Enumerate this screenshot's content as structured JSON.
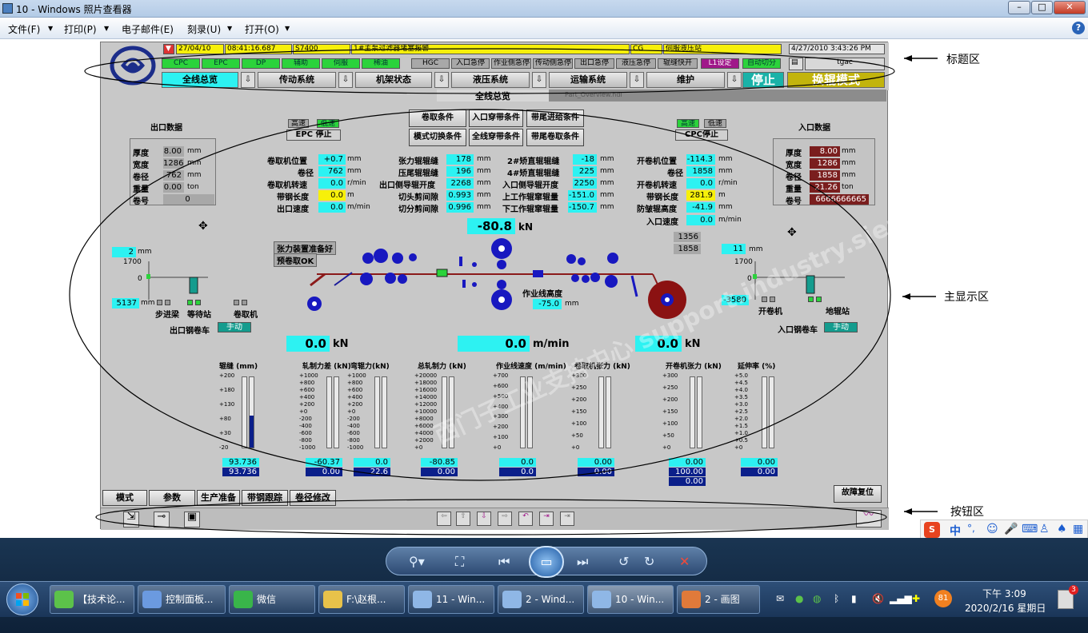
{
  "window": {
    "title": "10 - Windows 照片查看器"
  },
  "menu": [
    "文件(F)",
    "打印(P)",
    "电子邮件(E)",
    "刻录(U)",
    "打开(O)"
  ],
  "hmi": {
    "alarm": {
      "date": "27/04/10",
      "time": "08:41:16.687",
      "code": "S7400",
      "msg": "1#主泵过滤器堵塞报警",
      "cg": "CG",
      "station": "伺服液压站",
      "datetime": "4/27/2010 3:43:26 PM"
    },
    "status_row": [
      "CPC",
      "EPC",
      "DP",
      "辅助",
      "伺服",
      "稀油",
      "HGC",
      "入口急停",
      "作业侧急停",
      "传动侧急停",
      "出口急停",
      "液压急停",
      "辊缝快开",
      "L1设定",
      "自动切分"
    ],
    "user": "tgac",
    "nav": [
      "全线总览",
      "传动系统",
      "机架状态",
      "液压系统",
      "运输系统",
      "维护"
    ],
    "stop": "停止",
    "mode": "换辊模式",
    "page_title": "全线总览",
    "page_file": "Part_Overview.hdl",
    "exit_box": {
      "title": "出口数据",
      "rows": [
        {
          "label": "厚度",
          "value": "8.00",
          "unit": "mm"
        },
        {
          "label": "宽度",
          "value": "1286",
          "unit": "mm"
        },
        {
          "label": "卷径",
          "value": "762",
          "unit": "mm"
        },
        {
          "label": "重量",
          "value": "0.00",
          "unit": "ton"
        },
        {
          "label": "卷号",
          "value": "0",
          "unit": ""
        }
      ]
    },
    "entry_box": {
      "title": "入口数据",
      "rows": [
        {
          "label": "厚度",
          "value": "8.00",
          "unit": "mm"
        },
        {
          "label": "宽度",
          "value": "1286",
          "unit": "mm"
        },
        {
          "label": "卷径",
          "value": "1858",
          "unit": "mm"
        },
        {
          "label": "重量",
          "value": "21.26",
          "unit": "ton"
        },
        {
          "label": "卷号",
          "value": "6666666665",
          "unit": ""
        }
      ]
    },
    "epc": {
      "hi": "高速",
      "lo": "低速",
      "label": "EPC 停止"
    },
    "cpc": {
      "hi": "高速",
      "lo": "低速",
      "label": "CPC停止"
    },
    "conditions": [
      "卷取条件",
      "入口穿带条件",
      "带尾进给条件",
      "模式切换条件",
      "全线穿带条件",
      "带尾卷取条件"
    ],
    "col1": [
      {
        "label": "卷取机位置",
        "value": "+0.7",
        "unit": "mm"
      },
      {
        "label": "卷径",
        "value": "762",
        "unit": "mm"
      },
      {
        "label": "卷取机转速",
        "value": "0.0",
        "unit": "r/min"
      },
      {
        "label": "带钢长度",
        "value": "0.0",
        "unit": "m"
      },
      {
        "label": "出口速度",
        "value": "0.0",
        "unit": "m/min"
      }
    ],
    "col2": [
      {
        "label": "张力辊辊缝",
        "value": "178",
        "unit": "mm"
      },
      {
        "label": "压尾辊辊缝",
        "value": "196",
        "unit": "mm"
      },
      {
        "label": "出口侧导辊开度",
        "value": "2268",
        "unit": "mm"
      },
      {
        "label": "切头剪间隙",
        "value": "0.993",
        "unit": "mm"
      },
      {
        "label": "切分剪间隙",
        "value": "0.996",
        "unit": "mm"
      }
    ],
    "col3": [
      {
        "label": "2#矫直辊辊缝",
        "value": "-18",
        "unit": "mm"
      },
      {
        "label": "4#矫直辊辊缝",
        "value": "225",
        "unit": "mm"
      },
      {
        "label": "入口侧导辊开度",
        "value": "2250",
        "unit": "mm"
      },
      {
        "label": "上工作辊窜辊量",
        "value": "-151.0",
        "unit": "mm"
      },
      {
        "label": "下工作辊窜辊量",
        "value": "-150.7",
        "unit": "mm"
      }
    ],
    "col4": [
      {
        "label": "开卷机位置",
        "value": "-114.3",
        "unit": "mm"
      },
      {
        "label": "卷径",
        "value": "1858",
        "unit": "mm"
      },
      {
        "label": "开卷机转速",
        "value": "0.0",
        "unit": "r/min"
      },
      {
        "label": "带钢长度",
        "value": "281.9",
        "unit": "m"
      },
      {
        "label": "防皱辊高度",
        "value": "-41.9",
        "unit": "mm"
      },
      {
        "label": "入口速度",
        "value": "0.0",
        "unit": "m/min"
      }
    ],
    "mid": {
      "force": "-80.8",
      "force_unit": "kN",
      "v1356": "1356",
      "v1858": "1858",
      "mm_l": "2",
      "mm_r": "11",
      "passline_label": "作业线高度",
      "passline": "-75.0",
      "passline_unit": "mm",
      "tension_ready": "张力装置准备好",
      "precoil_ok": "预卷取OK"
    },
    "left_area": {
      "v1700": "1700",
      "v0": "0",
      "pos": "5137",
      "pos_unit": "mm",
      "labels": [
        "步进梁",
        "等待站",
        "卷取机"
      ],
      "car": "出口钢卷车",
      "car_mode": "手动"
    },
    "right_area": {
      "v1700": "1700",
      "v0": "0",
      "pos": "-3580",
      "pos_unit": "mm",
      "labels": [
        "开卷机",
        "地辊站"
      ],
      "car": "入口钢卷车",
      "car_mode": "手动"
    },
    "bottom_big": [
      {
        "value": "0.0",
        "unit": "kN"
      },
      {
        "value": "0.0",
        "unit": "m/min"
      },
      {
        "value": "0.0",
        "unit": "kN"
      }
    ],
    "gauges": [
      {
        "title": "辊缝 (mm)",
        "ticks": [
          "+200",
          "+180",
          "+130",
          "+80",
          "+30",
          "-20"
        ],
        "v1": "93.736",
        "v2": "93.736",
        "fill": 0.45
      },
      {
        "title": "轧制力差 (kN)",
        "ticks": [
          "+1000",
          "+800",
          "+600",
          "+400",
          "+200",
          "+0",
          "-200",
          "-400",
          "-600",
          "-800",
          "-1000"
        ],
        "v1": "-60.37",
        "v2": "0.00",
        "fill": 0.0
      },
      {
        "title": "弯辊力(kN)",
        "ticks": [
          "+1000",
          "+800",
          "+600",
          "+400",
          "+200",
          "+0",
          "-200",
          "-400",
          "-600",
          "-800",
          "-1000"
        ],
        "v1": "0.0",
        "v2": "22.6",
        "fill": 0.0
      },
      {
        "title": "总轧制力 (kN)",
        "ticks": [
          "+20000",
          "+18000",
          "+16000",
          "+14000",
          "+12000",
          "+10000",
          "+8000",
          "+6000",
          "+4000",
          "+2000",
          "+0"
        ],
        "v1": "-80.85",
        "v2": "0.00",
        "fill": 0.0
      },
      {
        "title": "作业线速度 (m/min)",
        "ticks": [
          "+700",
          "+600",
          "+500",
          "+400",
          "+300",
          "+200",
          "+100",
          "+0"
        ],
        "v1": "0.0",
        "v2": "0.0",
        "fill": 0.0
      },
      {
        "title": "卷取机张力 (kN)",
        "ticks": [
          "+300",
          "+250",
          "+200",
          "+150",
          "+100",
          "+50",
          "+0"
        ],
        "v1": "0.00",
        "v2": "0.00",
        "fill": 0.0
      },
      {
        "title": "开卷机张力 (kN)",
        "ticks": [
          "+300",
          "+250",
          "+200",
          "+150",
          "+100",
          "+50",
          "+0"
        ],
        "v1": "0.00",
        "v2": "100.00",
        "v3": "0.00",
        "fill": 0.0
      },
      {
        "title": "延伸率 (%)",
        "ticks": [
          "+5.0",
          "+4.5",
          "+4.0",
          "+3.5",
          "+3.0",
          "+2.5",
          "+2.0",
          "+1.5",
          "+1.0",
          "+0.5",
          "+0"
        ],
        "v1": "0.00",
        "v2": "0.00",
        "fill": 0.0
      }
    ],
    "tabs": [
      "模式",
      "参数",
      "生产准备",
      "带钢跟踪",
      "卷径修改"
    ],
    "fault_reset": "故障复位"
  },
  "annotations": [
    "标题区",
    "主显示区",
    "按钮区"
  ],
  "watermark": "西门子工业支持中心 support.industry.siemens.com/cs",
  "ime": [
    "中",
    "°,"
  ],
  "taskbar": {
    "items": [
      "【技术论...",
      "控制面板...",
      "微信",
      "F:\\赵根...",
      "11 - Win...",
      "2 - Wind...",
      "10 - Win...",
      "2 - 画图"
    ],
    "battery": "81",
    "time": "下午 3:09",
    "date": "2020/2/16 星期日",
    "badge": "3"
  }
}
